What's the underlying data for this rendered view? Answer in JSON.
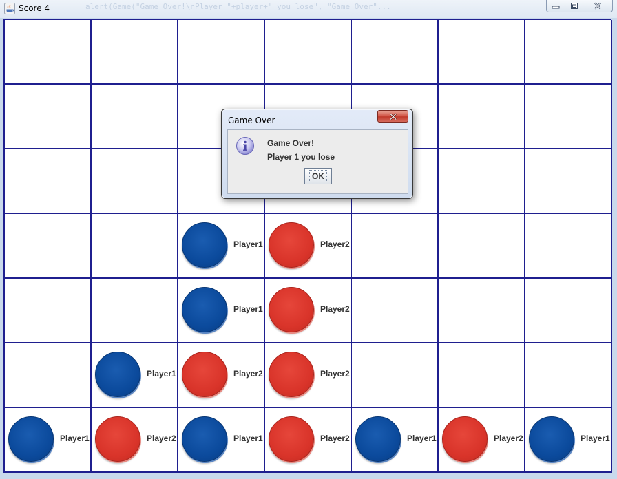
{
  "window": {
    "title": "Score 4",
    "background_code": "alert(Game(\"Game Over!\\nPlayer \"+player+\" you lose\", \"Game Over\"..."
  },
  "board": {
    "columns": 7,
    "rows": 7,
    "grid_color": "#1f1f8f",
    "player_colors": {
      "Player1": "#0b4a9c",
      "Player2": "#d9342a"
    },
    "discs": [
      {
        "row": 3,
        "col": 2,
        "player": "Player1",
        "color": "blue",
        "label": "Player1"
      },
      {
        "row": 3,
        "col": 3,
        "player": "Player2",
        "color": "red",
        "label": "Player2"
      },
      {
        "row": 4,
        "col": 2,
        "player": "Player1",
        "color": "blue",
        "label": "Player1"
      },
      {
        "row": 4,
        "col": 3,
        "player": "Player2",
        "color": "red",
        "label": "Player2"
      },
      {
        "row": 5,
        "col": 1,
        "player": "Player1",
        "color": "blue",
        "label": "Player1"
      },
      {
        "row": 5,
        "col": 2,
        "player": "Player2",
        "color": "red",
        "label": "Player2"
      },
      {
        "row": 5,
        "col": 3,
        "player": "Player2",
        "color": "red",
        "label": "Player2"
      },
      {
        "row": 6,
        "col": 0,
        "player": "Player1",
        "color": "blue",
        "label": "Player1"
      },
      {
        "row": 6,
        "col": 1,
        "player": "Player2",
        "color": "red",
        "label": "Player2"
      },
      {
        "row": 6,
        "col": 2,
        "player": "Player1",
        "color": "blue",
        "label": "Player1"
      },
      {
        "row": 6,
        "col": 3,
        "player": "Player2",
        "color": "red",
        "label": "Player2"
      },
      {
        "row": 6,
        "col": 4,
        "player": "Player1",
        "color": "blue",
        "label": "Player1"
      },
      {
        "row": 6,
        "col": 5,
        "player": "Player2",
        "color": "red",
        "label": "Player2"
      },
      {
        "row": 6,
        "col": 6,
        "player": "Player1",
        "color": "blue",
        "label": "Player1"
      }
    ]
  },
  "dialog": {
    "title": "Game Over",
    "icon": "info-icon",
    "message_line1": "Game Over!",
    "message_line2": "Player 1 you lose",
    "ok_label": "OK"
  }
}
